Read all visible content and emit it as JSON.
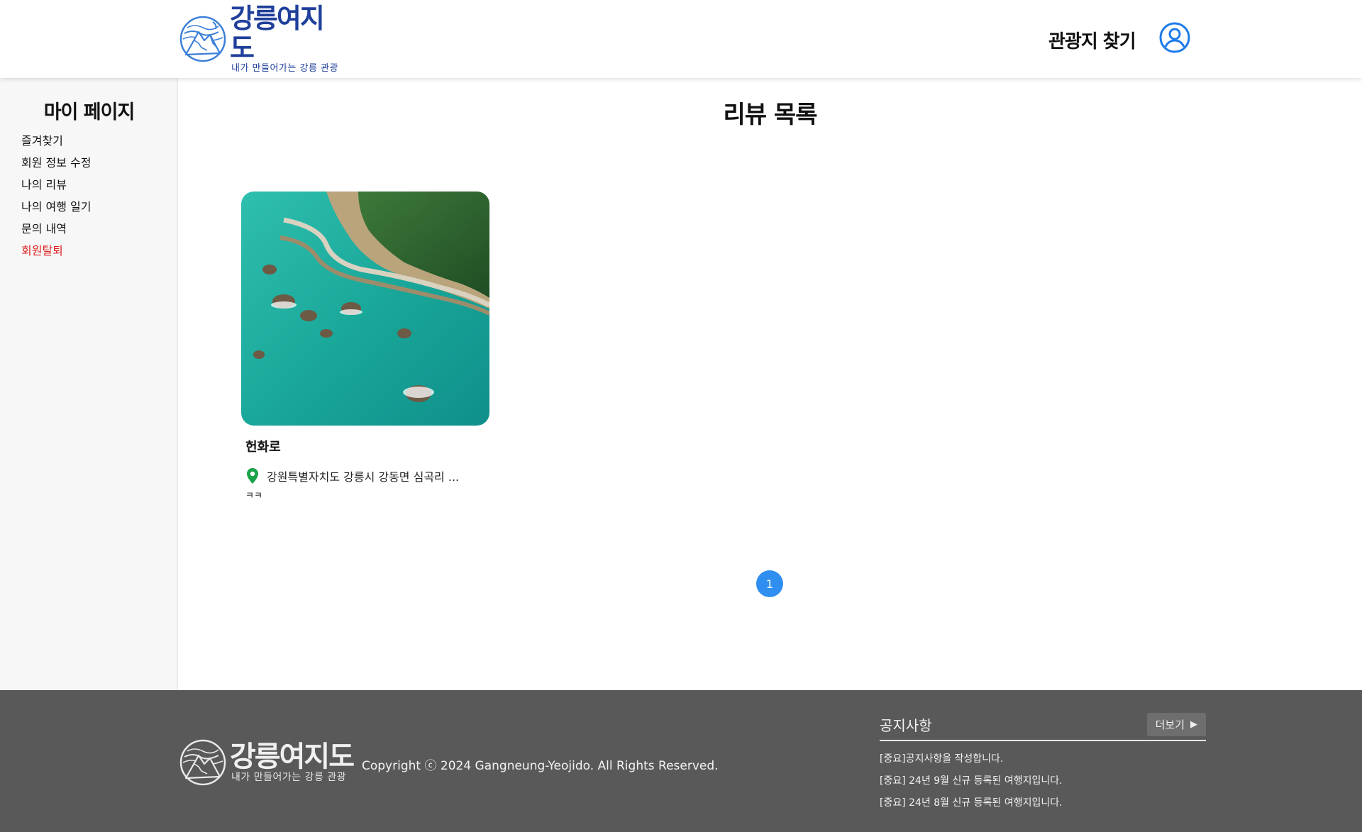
{
  "header": {
    "logo": {
      "title": "강릉여지도",
      "subtitle": "내가 만들어가는 강릉 관광"
    },
    "nav_link": "관광지 찾기",
    "user_icon": "user-circle-icon"
  },
  "sidebar": {
    "title": "마이 페이지",
    "items": [
      {
        "label": "즐겨찾기"
      },
      {
        "label": "회원 정보 수정"
      },
      {
        "label": "나의 리뷰"
      },
      {
        "label": "나의 여행 일기"
      },
      {
        "label": "문의 내역"
      },
      {
        "label": "회원탈퇴"
      }
    ]
  },
  "main": {
    "title": "리뷰 목록",
    "reviews": [
      {
        "name": "헌화로",
        "address": "강원특별자치도 강릉시 강동면 심곡리 ...",
        "review": "ㅋㅋ",
        "pin_icon": "location-pin-icon"
      }
    ],
    "pagination": {
      "current": "1"
    }
  },
  "footer": {
    "logo": {
      "title": "강릉여지도",
      "subtitle": "내가 만들어가는 강릉 관광"
    },
    "copyright": "Copyright ⓒ 2024 Gangneung-Yeojido. All Rights Reserved.",
    "notice": {
      "title": "공지사항",
      "more_label": "더보기",
      "items": [
        "[중요]공지사항을 작성합니다.",
        "[중요] 24년 9월 신규 등록된 여행지입니다.",
        "[중요] 24년 8월 신규 등록된 여행지입니다."
      ]
    }
  },
  "colors": {
    "brand_blue": "#1f3f9a",
    "accent_blue": "#2f8ff0",
    "danger_red": "#e02020",
    "pin_green": "#1aa34a",
    "footer_bg": "#595959",
    "sidebar_bg": "#f7f7f7"
  }
}
